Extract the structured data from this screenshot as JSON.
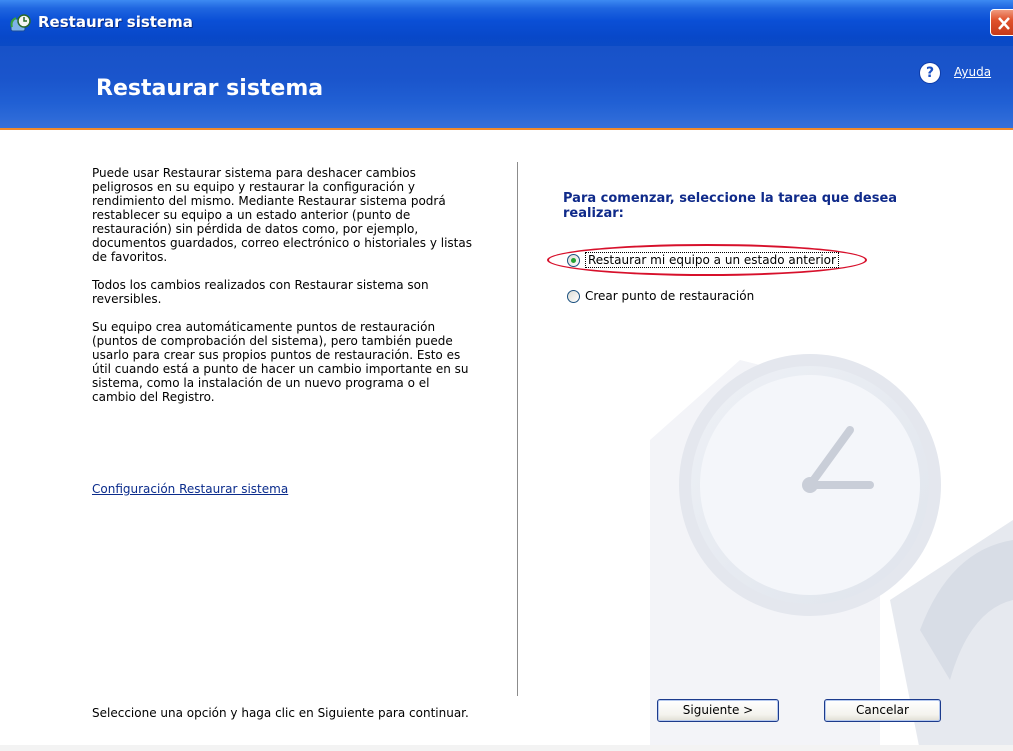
{
  "window": {
    "title": "Restaurar sistema",
    "close_label": "X"
  },
  "header": {
    "heading": "Restaurar sistema",
    "help_icon": "?",
    "help_label": "Ayuda"
  },
  "left": {
    "paragraphs": [
      "Puede usar Restaurar sistema para deshacer cambios peligrosos en su equipo y restaurar la configuración y rendimiento del mismo. Mediante Restaurar sistema podrá restablecer su equipo a un estado anterior (punto de restauración) sin pérdida de datos como, por ejemplo, documentos guardados, correo electrónico o historiales y listas de favoritos.",
      "Todos los cambios realizados con Restaurar sistema son reversibles.",
      "Su equipo crea automáticamente puntos de restauración (puntos de comprobación del sistema), pero también puede usarlo para crear sus propios puntos de restauración. Esto es útil cuando está a punto de hacer un cambio importante en su sistema, como la instalación de un nuevo programa o el cambio del Registro."
    ],
    "config_link": "Configuración Restaurar sistema",
    "bottom_hint": "Seleccione una opción y haga clic en Siguiente para continuar."
  },
  "right": {
    "task_title": "Para comenzar, seleccione la tarea que desea realizar:",
    "options": [
      {
        "label": "Restaurar mi equipo a un estado anterior",
        "checked": true
      },
      {
        "label": "Crear punto de restauración",
        "checked": false
      }
    ]
  },
  "buttons": {
    "next": "Siguiente >",
    "cancel": "Cancelar"
  },
  "colors": {
    "titlebar": "#0a4fd6",
    "header": "#1a55cc",
    "accent_line": "#ef8a2c",
    "task_title": "#0f2a8a",
    "highlight": "#d7102b"
  },
  "icons": {
    "app": "system-restore-icon",
    "help": "help-icon",
    "watermark": "clock-restore-watermark"
  }
}
